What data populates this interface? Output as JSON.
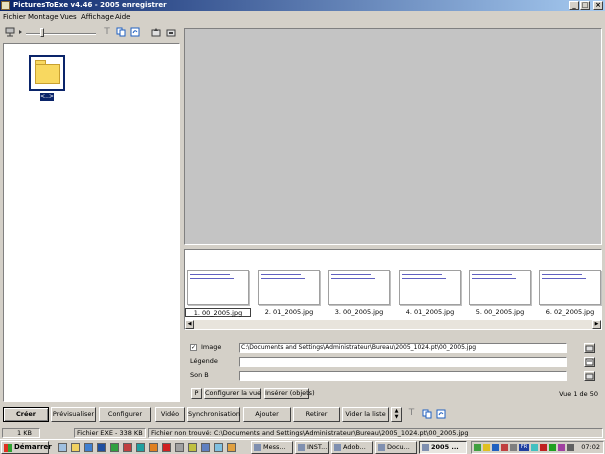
{
  "window": {
    "title": "PicturesToExe v4.46 - 2005 enregistrer",
    "controls": {
      "minimize": "_",
      "maximize": "□",
      "close": "×"
    }
  },
  "menu": [
    "Fichier",
    "Montage",
    "Vues",
    "Affichage",
    "Aide"
  ],
  "toolbar": {
    "icons": [
      "network-drive-icon",
      "text-icon",
      "copy-icon",
      "refresh-icon",
      "up-folder-icon",
      "new-folder-icon"
    ],
    "text_icon_glyph": "T"
  },
  "file_panel": {
    "selected_folder_label": "<..>"
  },
  "filmstrip": {
    "thumbnails": [
      {
        "label": "1. 00_2005.jpg",
        "selected": true
      },
      {
        "label": "2. 01_2005.jpg",
        "selected": false
      },
      {
        "label": "3. 00_2005.jpg",
        "selected": false
      },
      {
        "label": "4. 01_2005.jpg",
        "selected": false
      },
      {
        "label": "5. 00_2005.jpg",
        "selected": false
      },
      {
        "label": "6. 02_2005.jpg",
        "selected": false
      }
    ]
  },
  "properties": {
    "image_label": "Image",
    "image_checked": true,
    "image_path": "C:\\Documents and Settings\\Administrateur\\Bureau\\2005_1024.pt\\00_2005.jpg",
    "legend_label": "Légende",
    "legend_value": "",
    "sound_label": "Son B",
    "sound_value": "",
    "p_button": "P",
    "configure_view": "Configurer la vue",
    "insert_objects": "Insérer (objets)",
    "view_counter": "Vue 1 de 50"
  },
  "buttons": {
    "create": "Créer",
    "preview": "Prévisualiser",
    "configure": "Configurer",
    "video": "Vidéo",
    "sync": "Synchronisation",
    "add": "Ajouter",
    "remove": "Retirer",
    "clear_list": "Vider la liste",
    "text_glyph": "T"
  },
  "status": {
    "size": "1 KB",
    "exe": "Fichier EXE - 338 KB",
    "message": "Fichier non trouvé: C:\\Documents and Settings\\Administrateur\\Bureau\\2005_1024.pt\\00_2005.jpg"
  },
  "taskbar": {
    "start": "Démarrer",
    "tasks": [
      {
        "label": "Mess...",
        "active": false
      },
      {
        "label": "INST...",
        "active": false
      },
      {
        "label": "Adob...",
        "active": false
      },
      {
        "label": "Docu...",
        "active": false
      },
      {
        "label": "2005 ...",
        "active": true
      }
    ],
    "clock": "07:02",
    "tray_badge": "FR"
  }
}
